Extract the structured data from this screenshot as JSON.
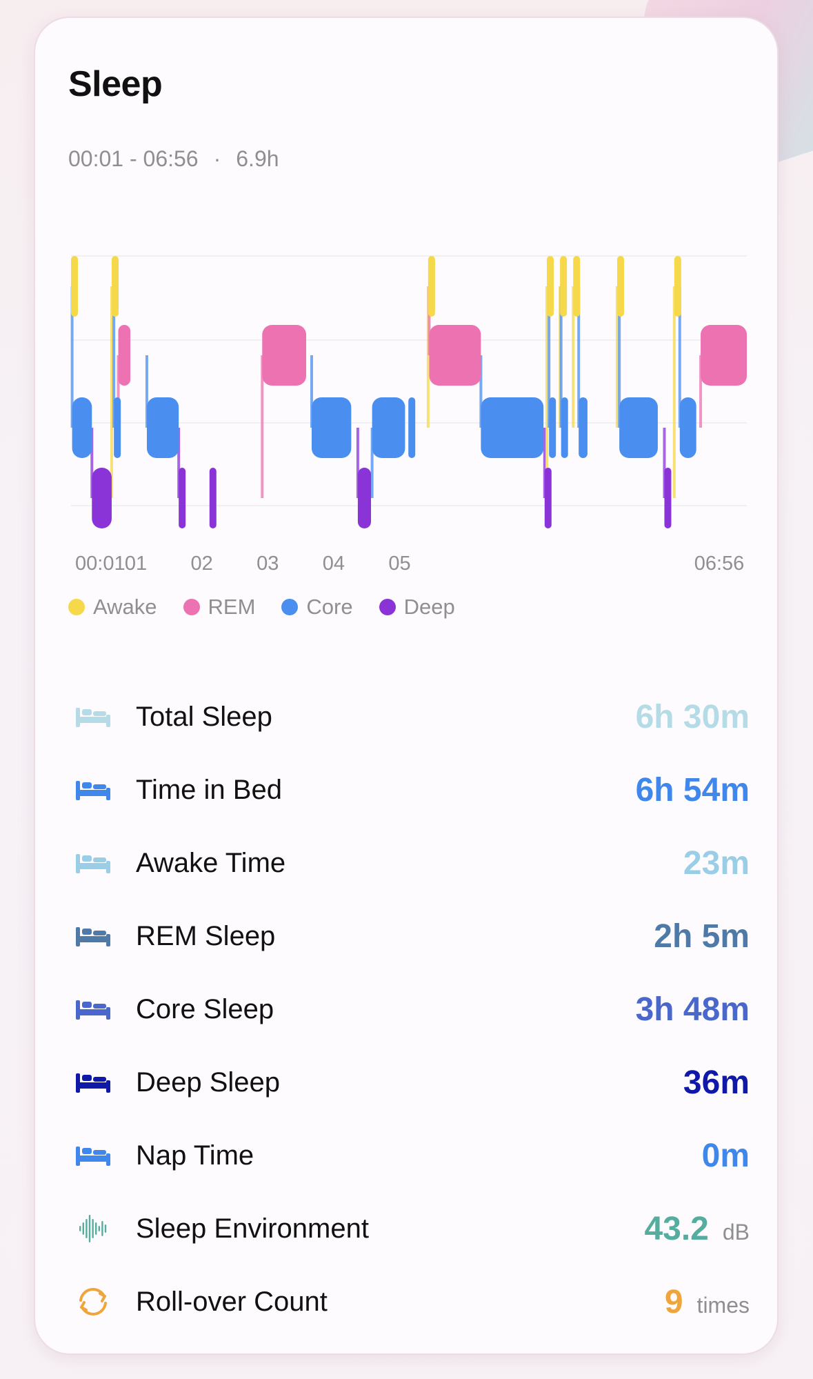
{
  "card": {
    "title": "Sleep",
    "range": "00:01 - 06:56",
    "separator": "·",
    "duration": "6.9h"
  },
  "chart_data": {
    "type": "timeline",
    "stages": [
      "Awake",
      "REM",
      "Core",
      "Deep"
    ],
    "x_tick_labels": [
      "00:01",
      "01",
      "02",
      "03",
      "04",
      "05",
      "06:56"
    ],
    "x_tick_minutes": [
      1,
      60,
      120,
      180,
      240,
      300,
      416
    ],
    "start_minute": 1,
    "end_minute": 416,
    "segments": [
      {
        "stage": "Awake",
        "start": 1,
        "end": 2
      },
      {
        "stage": "Core",
        "start": 2,
        "end": 20
      },
      {
        "stage": "Deep",
        "start": 20,
        "end": 38
      },
      {
        "stage": "Awake",
        "start": 38,
        "end": 39
      },
      {
        "stage": "Core",
        "start": 40,
        "end": 43
      },
      {
        "stage": "REM",
        "start": 44,
        "end": 55
      },
      {
        "stage": "Core",
        "start": 70,
        "end": 99
      },
      {
        "stage": "Deep",
        "start": 99,
        "end": 104
      },
      {
        "stage": "Deep",
        "start": 127,
        "end": 132
      },
      {
        "stage": "REM",
        "start": 175,
        "end": 215
      },
      {
        "stage": "Core",
        "start": 220,
        "end": 256
      },
      {
        "stage": "Deep",
        "start": 262,
        "end": 274
      },
      {
        "stage": "Core",
        "start": 275,
        "end": 305
      },
      {
        "stage": "Core",
        "start": 308,
        "end": 311
      },
      {
        "stage": "Awake",
        "start": 326,
        "end": 327
      },
      {
        "stage": "REM",
        "start": 327,
        "end": 374
      },
      {
        "stage": "Core",
        "start": 374,
        "end": 431
      },
      {
        "stage": "Deep",
        "start": 432,
        "end": 433
      },
      {
        "stage": "Awake",
        "start": 434,
        "end": 435
      },
      {
        "stage": "Core",
        "start": 436,
        "end": 440
      },
      {
        "stage": "Awake",
        "start": 446,
        "end": 447
      },
      {
        "stage": "Core",
        "start": 447,
        "end": 452
      },
      {
        "stage": "Awake",
        "start": 458,
        "end": 459
      },
      {
        "stage": "Core",
        "start": 463,
        "end": 471
      },
      {
        "stage": "Awake",
        "start": 498,
        "end": 499
      },
      {
        "stage": "Core",
        "start": 500,
        "end": 535
      },
      {
        "stage": "Deep",
        "start": 541,
        "end": 545
      },
      {
        "stage": "Awake",
        "start": 550,
        "end": 551
      },
      {
        "stage": "Core",
        "start": 555,
        "end": 570
      },
      {
        "stage": "REM",
        "start": 574,
        "end": 616
      }
    ]
  },
  "legend": [
    {
      "label": "Awake",
      "color": "#f5d94a"
    },
    {
      "label": "REM",
      "color": "#ec72b1"
    },
    {
      "label": "Core",
      "color": "#4a8ef0"
    },
    {
      "label": "Deep",
      "color": "#8a34d8"
    }
  ],
  "stats": [
    {
      "icon": "bed-icon",
      "label": "Total Sleep",
      "value": "6h 30m",
      "unit": "",
      "color": "#b5dbe6"
    },
    {
      "icon": "bed-icon",
      "label": "Time in Bed",
      "value": "6h 54m",
      "unit": "",
      "color": "#3f87ea"
    },
    {
      "icon": "bed-icon",
      "label": "Awake Time",
      "value": "23m",
      "unit": "",
      "color": "#9acde6"
    },
    {
      "icon": "bed-icon",
      "label": "REM Sleep",
      "value": "2h 5m",
      "unit": "",
      "color": "#4f7aa7"
    },
    {
      "icon": "bed-icon",
      "label": "Core Sleep",
      "value": "3h 48m",
      "unit": "",
      "color": "#4a67cc"
    },
    {
      "icon": "bed-icon",
      "label": "Deep Sleep",
      "value": "36m",
      "unit": "",
      "color": "#1018a8"
    },
    {
      "icon": "bed-icon",
      "label": "Nap Time",
      "value": "0m",
      "unit": "",
      "color": "#3f87ea"
    },
    {
      "icon": "sound-wave-icon",
      "label": "Sleep Environment",
      "value": "43.2",
      "unit": "dB",
      "color": "#55ad9f"
    },
    {
      "icon": "rollover-icon",
      "label": "Roll-over Count",
      "value": "9",
      "unit": "times",
      "color": "#eea53c"
    }
  ]
}
